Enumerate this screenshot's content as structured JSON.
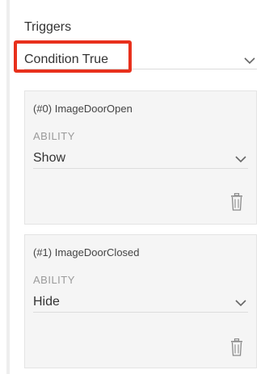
{
  "triggers": {
    "title": "Triggers",
    "selected": "Condition True",
    "chevron_icon": "chevron-down-icon",
    "highlight_color": "#e8301c"
  },
  "cards": [
    {
      "title": "(#0) ImageDoorOpen",
      "ability_label": "ABILITY",
      "ability_value": "Show",
      "delete_icon": "trash-icon"
    },
    {
      "title": "(#1) ImageDoorClosed",
      "ability_label": "ABILITY",
      "ability_value": "Hide",
      "delete_icon": "trash-icon"
    }
  ]
}
